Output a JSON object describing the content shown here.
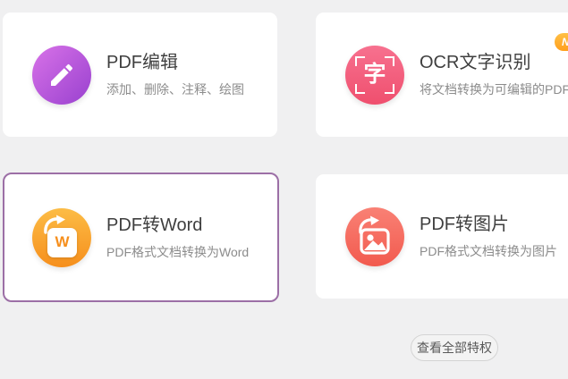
{
  "cards": [
    {
      "id": "pdf-edit",
      "title": "PDF编辑",
      "subtitle": "添加、删除、注释、绘图",
      "icon": "pencil-icon",
      "icon_gradient": [
        "#d872e8",
        "#9941cf"
      ]
    },
    {
      "id": "ocr",
      "title": "OCR文字识别",
      "subtitle": "将文档转换为可编辑的PDF文件",
      "icon": "ocr-scan-icon",
      "icon_char": "字",
      "icon_gradient": [
        "#f7718f",
        "#ef4f6e"
      ],
      "badge": "NEW"
    },
    {
      "id": "pdf-to-word",
      "title": "PDF转Word",
      "subtitle": "PDF格式文档转换为Word",
      "icon": "word-convert-icon",
      "icon_char": "W",
      "icon_gradient": [
        "#fcbc45",
        "#f68f1d"
      ],
      "selected": true,
      "selected_border_color": "#9c6fa6"
    },
    {
      "id": "pdf-to-image",
      "title": "PDF转图片",
      "subtitle": "PDF格式文档转换为图片",
      "icon": "image-convert-icon",
      "icon_gradient": [
        "#f98175",
        "#f25a4e"
      ]
    }
  ],
  "footer": {
    "view_all_label": "查看全部特权"
  },
  "colors": {
    "page_background": "#f0f0f1",
    "card_background": "#ffffff",
    "title_text": "#3f3f3f",
    "subtitle_text": "#8c8c8c",
    "badge_background": "#ffa82e"
  }
}
